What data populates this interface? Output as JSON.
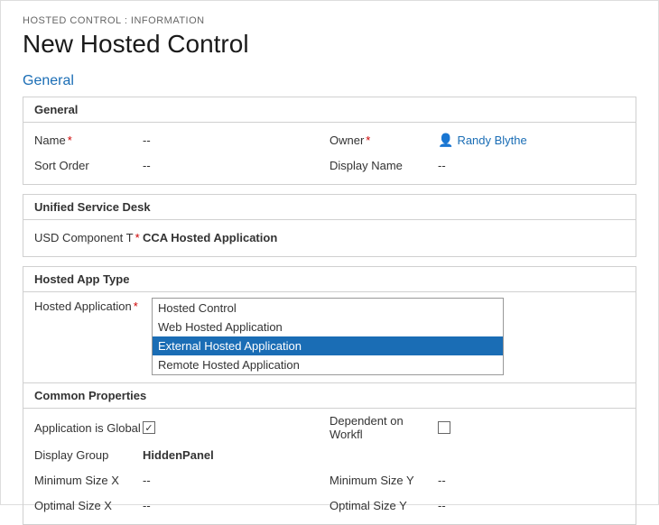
{
  "breadcrumb": "HOSTED CONTROL : INFORMATION",
  "page_title": "New Hosted Control",
  "general_section_heading": "General",
  "general_card": {
    "header": "General",
    "fields": {
      "name_label": "Name",
      "name_value": "--",
      "owner_label": "Owner",
      "owner_icon": "👤",
      "owner_name": "Randy Blythe",
      "sort_order_label": "Sort Order",
      "sort_order_value": "--",
      "display_name_label": "Display Name",
      "display_name_value": "--"
    }
  },
  "usd_card": {
    "header": "Unified Service Desk",
    "fields": {
      "usd_component_label": "USD Component T",
      "usd_component_value": "CCA Hosted Application"
    }
  },
  "hosted_app_card": {
    "header": "Hosted App Type",
    "hosted_application_label": "Hosted Application",
    "dropdown_items": [
      {
        "label": "Hosted Control",
        "selected": false
      },
      {
        "label": "Web Hosted Application",
        "selected": false
      },
      {
        "label": "External Hosted Application",
        "selected": true
      },
      {
        "label": "Remote Hosted Application",
        "selected": false
      }
    ]
  },
  "common_properties": {
    "header": "Common Properties",
    "fields": {
      "app_is_global_label": "Application is Global",
      "app_is_global_checked": true,
      "dependent_label": "Dependent on Workfl",
      "dependent_checked": false,
      "display_group_label": "Display Group",
      "display_group_value": "HiddenPanel",
      "min_size_x_label": "Minimum Size X",
      "min_size_x_value": "--",
      "min_size_y_label": "Minimum Size Y",
      "min_size_y_value": "--",
      "optimal_size_x_label": "Optimal Size X",
      "optimal_size_x_value": "--",
      "optimal_size_y_label": "Optimal Size Y",
      "optimal_size_y_value": "--"
    }
  }
}
